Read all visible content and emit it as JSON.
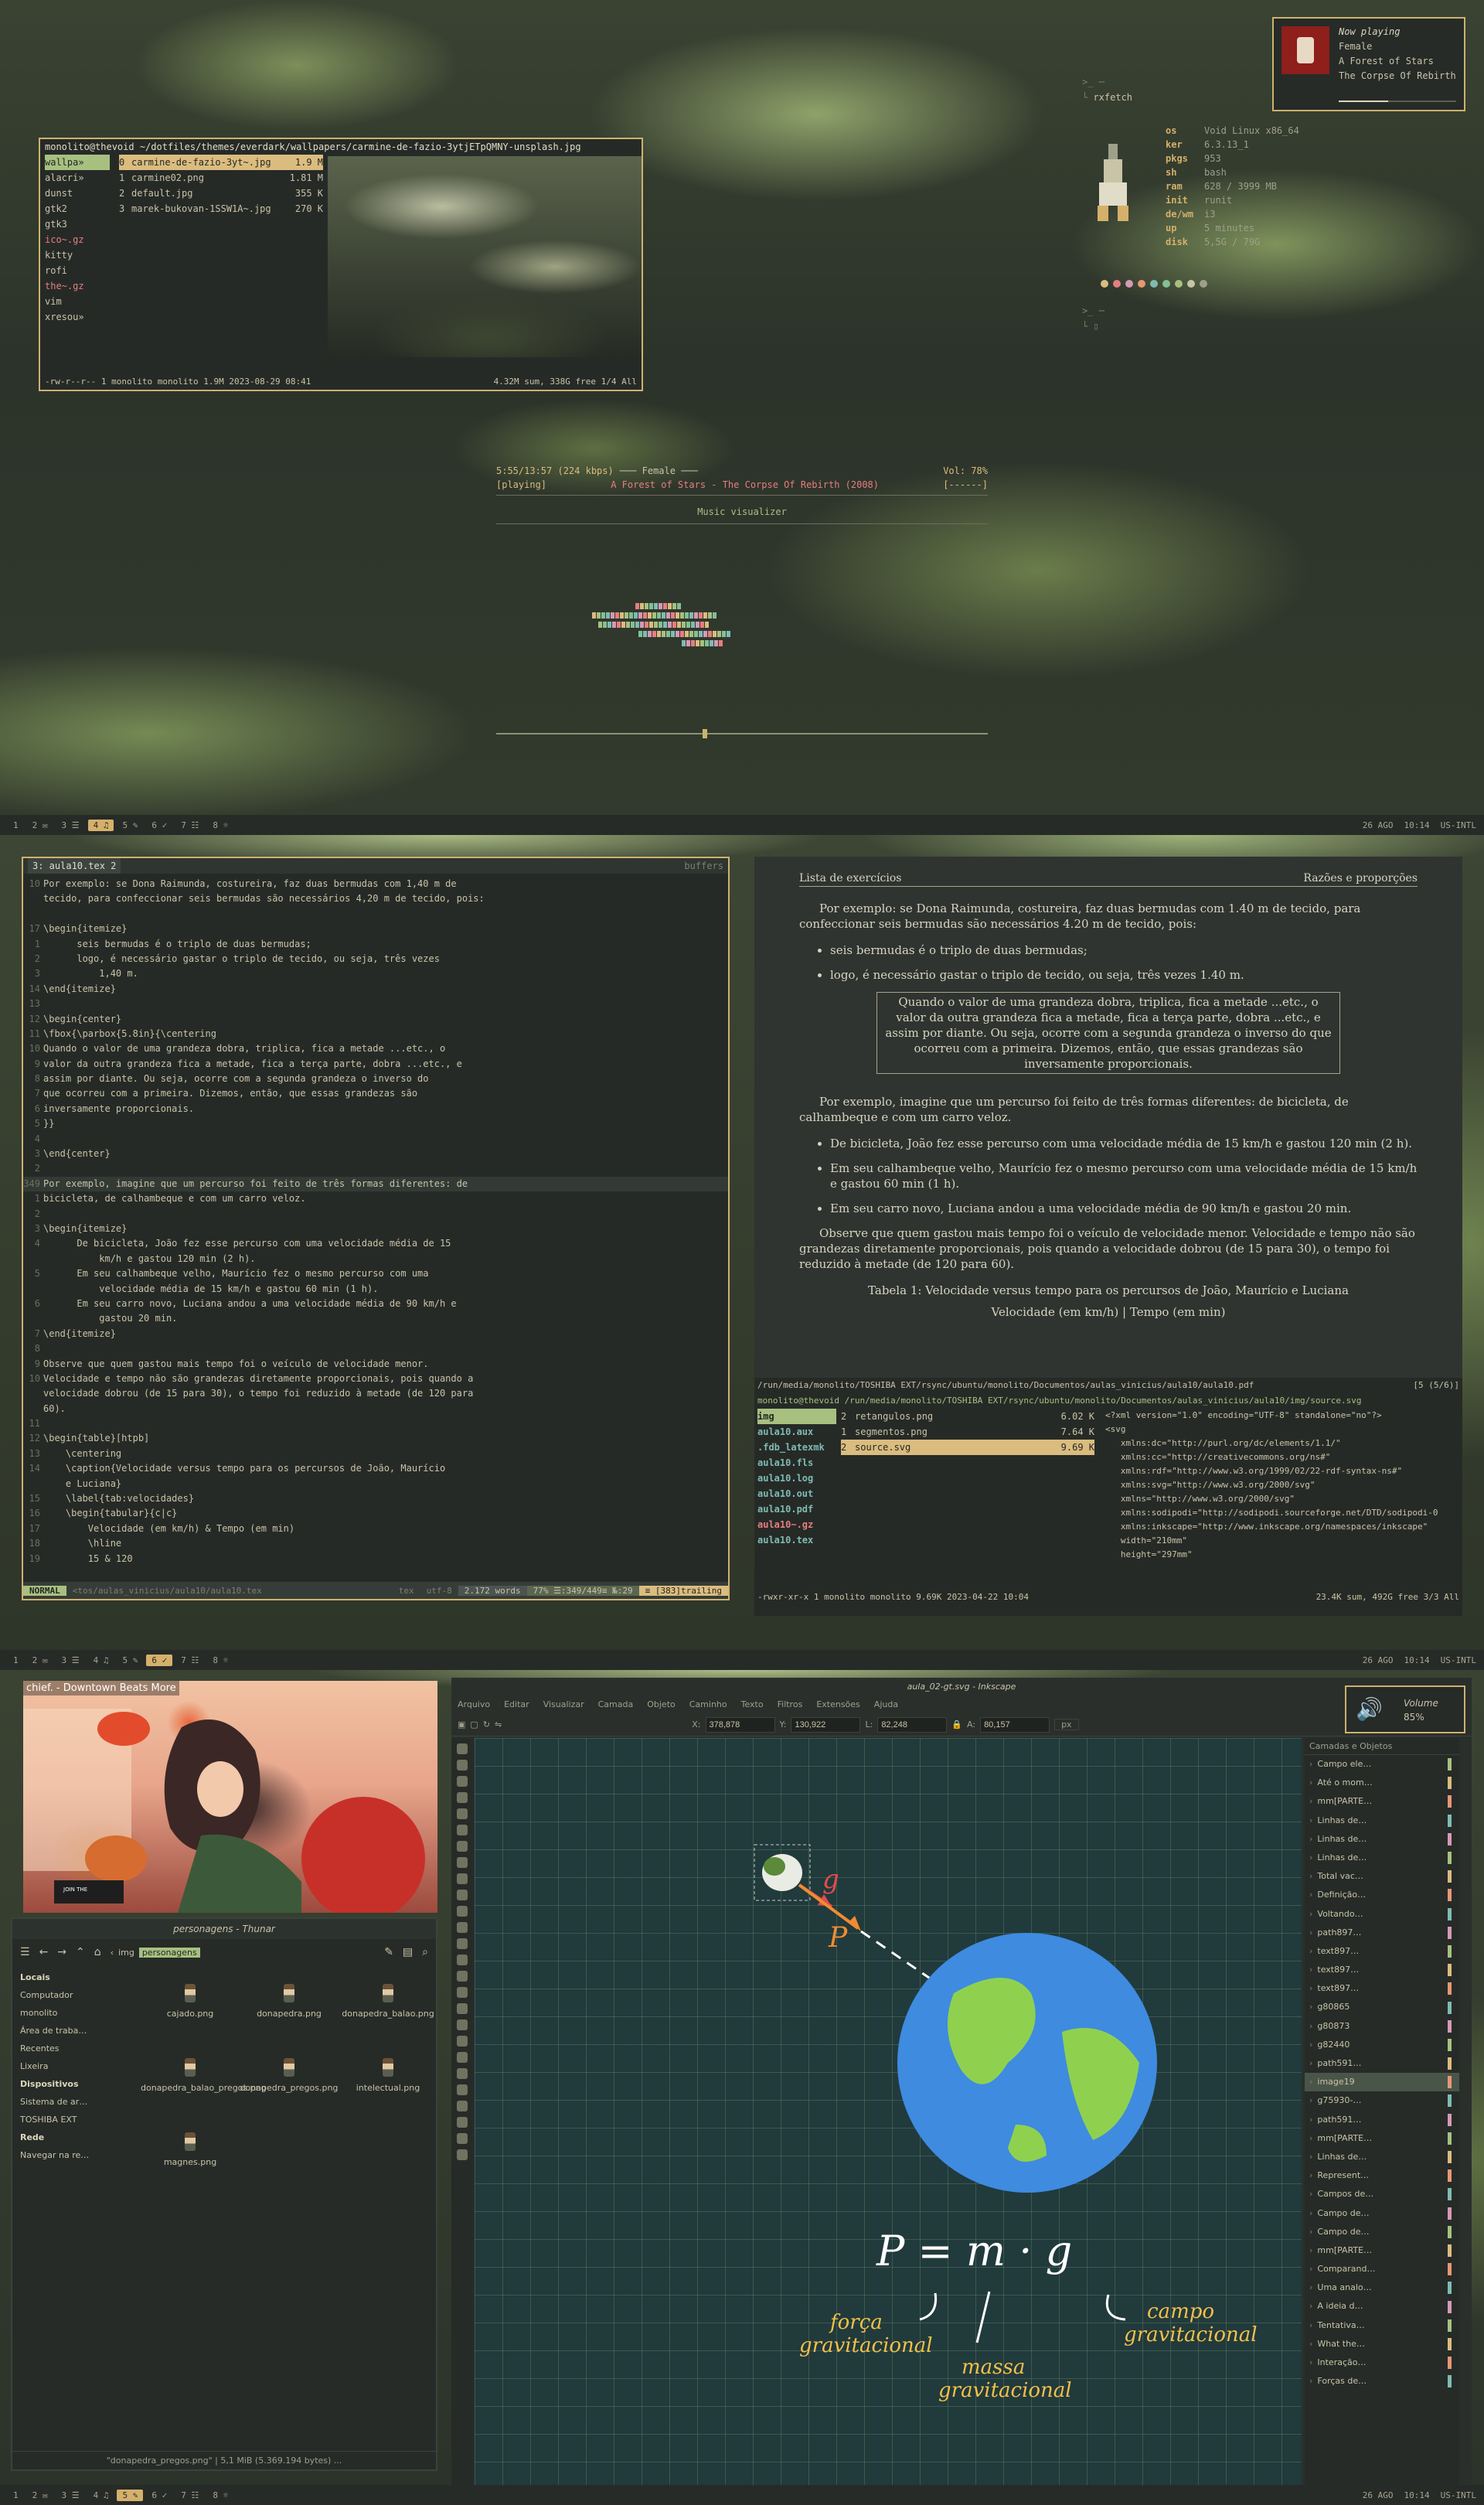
{
  "colors": {
    "accent": "#cdb26e",
    "green": "#a7c080",
    "bar_bg": "#262b28"
  },
  "bar": {
    "workspaces": [
      "1",
      "2 ✉",
      "3 ☰",
      "4 ♫",
      "5 ✎",
      "6 ✓",
      "7 ☷",
      "8 ☼"
    ],
    "date": "26 AGO",
    "time": "10:14",
    "layout": "US-INTL"
  },
  "lf": {
    "title_path": "monolito@thevoid ~/dotfiles/themes/everdark/wallpapers/carmine-de-fazio-3ytjETpQMNY-unsplash.jpg",
    "dirs": [
      "wallpa»",
      "alacri»",
      "dunst",
      "gtk2",
      "gtk3",
      "ico~.gz",
      "kitty",
      "rofi",
      "the~.gz",
      "vim",
      "xresou»"
    ],
    "files": [
      {
        "n": "0",
        "name": "carmine-de-fazio-3yt~.jpg",
        "size": "1.9 M"
      },
      {
        "n": "1",
        "name": "carmine02.png",
        "size": "1.81 M"
      },
      {
        "n": "2",
        "name": "default.jpg",
        "size": "355 K"
      },
      {
        "n": "3",
        "name": "marek-bukovan-1SSW1A~.jpg",
        "size": "270 K"
      }
    ],
    "status_left": "-rw-r--r-- 1 monolito monolito 1.9M 2023-08-29 08:41",
    "status_right": "4.32M sum, 338G free  1/4  All"
  },
  "rxfetch": {
    "header": "rxfetch",
    "rows": [
      {
        "k": "os",
        "v": "Void Linux x86_64"
      },
      {
        "k": "ker",
        "v": "6.3.13_1"
      },
      {
        "k": "pkgs",
        "v": "953"
      },
      {
        "k": "sh",
        "v": "bash"
      },
      {
        "k": "ram",
        "v": "628 / 3999 MB"
      },
      {
        "k": "init",
        "v": "runit"
      },
      {
        "k": "de/wm",
        "v": "i3"
      },
      {
        "k": "up",
        "v": "5 minutes"
      },
      {
        "k": "disk",
        "v": "5,5G / 79G"
      }
    ]
  },
  "now_playing": {
    "label": "Now playing",
    "track": "Female",
    "artist": "A Forest of Stars",
    "album": "The Corpse Of Rebirth",
    "progress": 0.42
  },
  "mpc": {
    "time": "5:55/13:57 (224 kbps)",
    "title_bar": "─── Female ───",
    "volume": "Vol: 78%",
    "state": "[playing]",
    "song": "A Forest of Stars - The Corpse Of Rebirth (2008)",
    "flags": "[------]",
    "screen": "Music visualizer",
    "progress": 0.42
  },
  "editor": {
    "tab": "3: aula10.tex 2",
    "buffers": "buffers",
    "lines": [
      {
        "g": "10",
        "t": "Por exemplo: se Dona Raimunda, costureira, faz duas bermudas com 1,40 m de"
      },
      {
        "g": "",
        "t": "tecido, para confeccionar seis bermudas são necessários 4,20 m de tecido, pois:"
      },
      {
        "g": "",
        "t": ""
      },
      {
        "g": "17",
        "t": "\\begin{itemize}"
      },
      {
        "g": "1",
        "t": "      seis bermudas é o triplo de duas bermudas;"
      },
      {
        "g": "2",
        "t": "      logo, é necessário gastar o triplo de tecido, ou seja, três vezes"
      },
      {
        "g": "3",
        "t": "          1,40 m."
      },
      {
        "g": "14",
        "t": "\\end{itemize}"
      },
      {
        "g": "13",
        "t": ""
      },
      {
        "g": "12",
        "t": "\\begin{center}"
      },
      {
        "g": "11",
        "t": "\\fbox{\\parbox{5.8in}{\\centering"
      },
      {
        "g": "10",
        "t": "Quando o valor de uma grandeza dobra, triplica, fica a metade ...etc., o"
      },
      {
        "g": "9",
        "t": "valor da outra grandeza fica a metade, fica a terça parte, dobra ...etc., e"
      },
      {
        "g": "8",
        "t": "assim por diante. Ou seja, ocorre com a segunda grandeza o inverso do"
      },
      {
        "g": "7",
        "t": "que ocorreu com a primeira. Dizemos, então, que essas grandezas são"
      },
      {
        "g": "6",
        "t": "inversamente proporcionais."
      },
      {
        "g": "5",
        "t": "}}"
      },
      {
        "g": "4",
        "t": ""
      },
      {
        "g": "3",
        "t": "\\end{center}"
      },
      {
        "g": "2",
        "t": ""
      },
      {
        "g": "349",
        "t": "Por exemplo, imagine que um percurso foi feito de três formas diferentes: de"
      },
      {
        "g": "1",
        "t": "bicicleta, de calhambeque e com um carro veloz."
      },
      {
        "g": "2",
        "t": ""
      },
      {
        "g": "3",
        "t": "\\begin{itemize}"
      },
      {
        "g": "4",
        "t": "      De bicicleta, João fez esse percurso com uma velocidade média de 15"
      },
      {
        "g": "",
        "t": "          km/h e gastou 120 min (2 h)."
      },
      {
        "g": "5",
        "t": "      Em seu calhambeque velho, Maurício fez o mesmo percurso com uma"
      },
      {
        "g": "",
        "t": "          velocidade média de 15 km/h e gastou 60 min (1 h)."
      },
      {
        "g": "6",
        "t": "      Em seu carro novo, Luciana andou a uma velocidade média de 90 km/h e"
      },
      {
        "g": "",
        "t": "          gastou 20 min."
      },
      {
        "g": "7",
        "t": "\\end{itemize}"
      },
      {
        "g": "8",
        "t": ""
      },
      {
        "g": "9",
        "t": "Observe que quem gastou mais tempo foi o veículo de velocidade menor."
      },
      {
        "g": "10",
        "t": "Velocidade e tempo não são grandezas diretamente proporcionais, pois quando a"
      },
      {
        "g": "",
        "t": "velocidade dobrou (de 15 para 30), o tempo foi reduzido à metade (de 120 para"
      },
      {
        "g": "",
        "t": "60)."
      },
      {
        "g": "11",
        "t": ""
      },
      {
        "g": "12",
        "t": "\\begin{table}[htpb]"
      },
      {
        "g": "13",
        "t": "    \\centering"
      },
      {
        "g": "14",
        "t": "    \\caption{Velocidade versus tempo para os percursos de João, Maurício"
      },
      {
        "g": "",
        "t": "    e Luciana}"
      },
      {
        "g": "15",
        "t": "    \\label{tab:velocidades}"
      },
      {
        "g": "16",
        "t": "    \\begin{tabular}{c|c}"
      },
      {
        "g": "17",
        "t": "        Velocidade (em km/h) & Tempo (em min)"
      },
      {
        "g": "18",
        "t": "        \\hline"
      },
      {
        "g": "19",
        "t": "        15 & 120"
      }
    ],
    "status": {
      "mode": "NORMAL",
      "file": "<tos/aulas_vinicius/aula10/aula10.tex",
      "ft": "tex",
      "enc": "utf-8",
      "words": "2.172 words",
      "pos": "77% ☰:349/449≡ №:29",
      "trail": "≡ [383]trailing"
    }
  },
  "pdf": {
    "head_left": "Lista de exercícios",
    "head_right": "Razões e proporções",
    "p1": "Por exemplo: se Dona Raimunda, costureira, faz duas bermudas com 1.40 m de tecido, para confeccionar seis bermudas são necessários 4.20 m de tecido, pois:",
    "b1": "seis bermudas é o triplo de duas bermudas;",
    "b2": "logo, é necessário gastar o triplo de tecido, ou seja, três vezes 1.40 m.",
    "box": "Quando o valor de uma grandeza dobra, triplica, fica a metade ...etc., o valor da outra grandeza fica a metade, fica a terça parte, dobra ...etc., e assim por diante. Ou seja, ocorre com a segunda grandeza o inverso do que ocorreu com a primeira. Dizemos, então, que essas grandezas são inversamente proporcionais.",
    "p2": "Por exemplo, imagine que um percurso foi feito de três formas diferentes: de bicicleta, de calhambeque e com um carro veloz.",
    "b3": "De bicicleta, João fez esse percurso com uma velocidade média de 15 km/h e gastou 120 min (2 h).",
    "b4": "Em seu calhambeque velho, Maurício fez o mesmo percurso com uma velocidade média de 15 km/h e gastou 60 min (1 h).",
    "b5": "Em seu carro novo, Luciana andou a uma velocidade média de 90 km/h e gastou 20 min.",
    "p3": "Observe que quem gastou mais tempo foi o veículo de velocidade menor. Velocidade e tempo não são grandezas diretamente proporcionais, pois quando a velocidade dobrou (de 15 para 30), o tempo foi reduzido à metade (de 120 para 60).",
    "caption": "Tabela 1: Velocidade versus tempo para os percursos de João, Maurício e Luciana",
    "th": "Velocidade (em km/h) | Tempo (em min)",
    "path": "/run/media/monolito/TOSHIBA EXT/rsync/ubuntu/monolito/Documentos/aulas_vinicius/aula10/aula10.pdf",
    "page": "[5 (5/6)]"
  },
  "lf2": {
    "title": "monolito@thevoid /run/media/monolito/TOSHIBA EXT/rsync/ubuntu/monolito/Documentos/aulas_vinicius/aula10/img/source.svg",
    "dirs": [
      "img",
      "aula10.aux",
      ".fdb_latexmk",
      "aula10.fls",
      "aula10.log",
      "aula10.out",
      "aula10.pdf",
      "aula10~.gz",
      "aula10.tex"
    ],
    "files": [
      {
        "n": "2",
        "name": "retangulos.png",
        "size": "6.02 K"
      },
      {
        "n": "1",
        "name": "segmentos.png",
        "size": "7.64 K"
      },
      {
        "n": "2",
        "name": "source.svg",
        "size": "9.69 K"
      }
    ],
    "preview": [
      "<?xml version=\"1.0\" encoding=\"UTF-8\" standalone=\"no\"?>",
      "<svg",
      "   xmlns:dc=\"http://purl.org/dc/elements/1.1/\"",
      "   xmlns:cc=\"http://creativecommons.org/ns#\"",
      "   xmlns:rdf=\"http://www.w3.org/1999/02/22-rdf-syntax-ns#\"",
      "   xmlns:svg=\"http://www.w3.org/2000/svg\"",
      "   xmlns=\"http://www.w3.org/2000/svg\"",
      "   xmlns:sodipodi=\"http://sodipodi.sourceforge.net/DTD/sodipodi-0",
      "   xmlns:inkscape=\"http://www.inkscape.org/namespaces/inkscape\"",
      "   width=\"210mm\"",
      "   height=\"297mm\""
    ],
    "status_left": "-rwxr-xr-x 1 monolito monolito 9.69K 2023-04-22 10:04",
    "status_right": "23.4K sum, 492G free  3/3  All"
  },
  "video": {
    "title": "chief. - Downtown Beats More"
  },
  "thunar": {
    "title": "personagens - Thunar",
    "crumbs": [
      "img",
      "personagens"
    ],
    "side_h1": "Locais",
    "side1": [
      "Computador",
      "monolito",
      "Área de traba…",
      "Recentes",
      "Lixeira"
    ],
    "side_h2": "Dispositivos",
    "side2": [
      "Sistema de ar…",
      "TOSHIBA EXT"
    ],
    "side_h3": "Rede",
    "side3": [
      "Navegar na re…"
    ],
    "files": [
      "cajado.png",
      "donapedra.png",
      "donapedra_balao.png",
      "donapedra_balao_pregos.png",
      "donapedra_pregos.png",
      "intelectual.png",
      "magnes.png"
    ],
    "status": "\"donapedra_pregos.png\"  |  5,1 MiB (5.369.194 bytes) ..."
  },
  "inkscape": {
    "title": "aula_02-gt.svg - Inkscape",
    "menu": [
      "Arquivo",
      "Editar",
      "Visualizar",
      "Camada",
      "Objeto",
      "Caminho",
      "Texto",
      "Filtros",
      "Extensões",
      "Ajuda"
    ],
    "x": "378,878",
    "y": "130,922",
    "w": "82,248",
    "h": "80,157",
    "unit": "px",
    "panel_title": "Camadas e Objetos",
    "layers": [
      "Campo ele…",
      "Até o mom…",
      "mm[PARTE…",
      "Linhas de…",
      "Linhas de…",
      "Linhas de…",
      "Total vac…",
      "Definição…",
      "Voltando…",
      "path897…",
      "text897…",
      "text897…",
      "text897…",
      "g80865",
      "g80873",
      "g82440",
      "path591…",
      "image19",
      "g75930-…",
      "path591…",
      "mm[PARTE…",
      "Linhas de…",
      "Represent…",
      "Campos de…",
      "Campo de…",
      "Campo de…",
      "mm[PARTE…",
      "Comparand…",
      "Uma analo…",
      "A ideia d…",
      "Tentativa…",
      "What the…",
      "Interação…",
      "Forças de…"
    ],
    "vec_g": "g",
    "vec_p": "P",
    "formula": "P = m · g",
    "lbl_force": "força\ngravitacional",
    "lbl_mass": "massa\ngravitacional",
    "lbl_field": "campo\ngravitacional"
  },
  "volume": {
    "label": "Volume",
    "value": "85%"
  }
}
